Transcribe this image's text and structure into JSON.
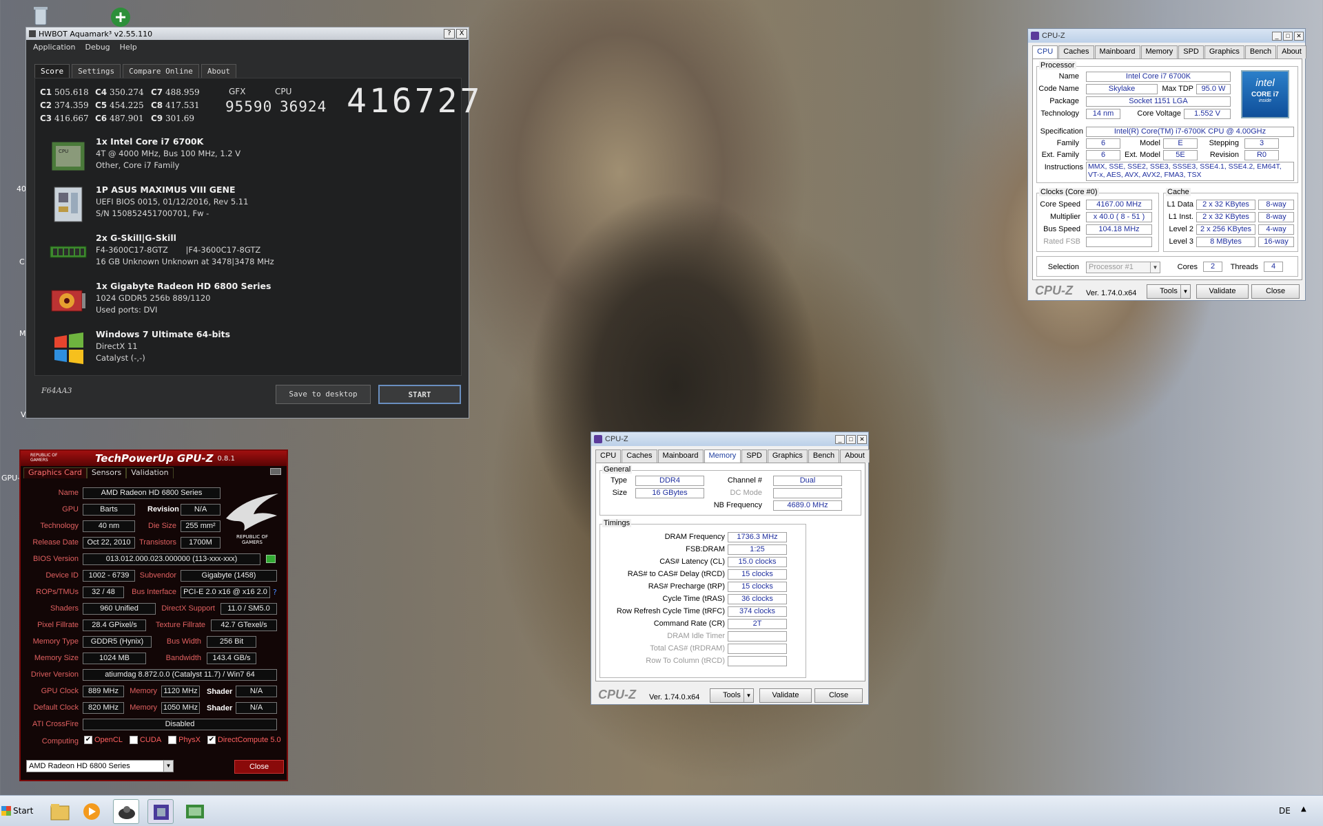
{
  "aquamark": {
    "title": "HWBOT Aquamark³ v2.55.110",
    "help_btn": "?",
    "close_btn": "X",
    "menu": [
      "Application",
      "Debug",
      "Help"
    ],
    "tabs": [
      "Score",
      "Settings",
      "Compare Online",
      "About"
    ],
    "chart_scores": [
      {
        "label": "C1",
        "value": "505.618"
      },
      {
        "label": "C2",
        "value": "374.359"
      },
      {
        "label": "C3",
        "value": "416.667"
      },
      {
        "label": "C4",
        "value": "350.274"
      },
      {
        "label": "C5",
        "value": "454.225"
      },
      {
        "label": "C6",
        "value": "487.901"
      },
      {
        "label": "C7",
        "value": "488.959"
      },
      {
        "label": "C8",
        "value": "417.531"
      },
      {
        "label": "C9",
        "value": "301.69"
      }
    ],
    "gfx_label": "GFX",
    "cpu_label": "CPU",
    "gfx_score": "95590",
    "cpu_score": "36924",
    "total_score": "416727",
    "system": [
      {
        "icon": "cpu-chip-icon",
        "lines": [
          "1x Intel Core i7 6700K",
          "4T @ 4000 MHz, Bus 100 MHz, 1.2 V",
          "Other, Core i7 Family"
        ]
      },
      {
        "icon": "motherboard-icon",
        "lines": [
          "1P ASUS MAXIMUS VIII GENE",
          "UEFI BIOS 0015, 01/12/2016, Rev 5.11",
          "S/N 150852451700701, Fw -"
        ]
      },
      {
        "icon": "memory-module-icon",
        "lines": [
          "2x G-Skill|G-Skill",
          "F4-3600C17-8GTZ       |F4-3600C17-8GTZ",
          "16 GB Unknown Unknown at 3478|3478 MHz"
        ]
      },
      {
        "icon": "graphics-card-icon",
        "lines": [
          "1x Gigabyte Radeon HD 6800 Series",
          "1024 GDDR5 256b 889/1120",
          "Used ports: DVI"
        ]
      },
      {
        "icon": "windows-logo-icon",
        "lines": [
          "Windows 7 Ultimate 64-bits",
          "DirectX 11",
          "Catalyst (-,-)"
        ]
      }
    ],
    "code": "F64AA3",
    "save_btn": "Save to desktop",
    "start_btn": "START"
  },
  "gpuz": {
    "brand": "REPUBLIC OF GAMERS",
    "title": "TechPowerUp GPU-Z",
    "version": "0.8.1",
    "tabs": [
      "Graphics Card",
      "Sensors",
      "Validation"
    ],
    "labels": {
      "name": "Name",
      "gpu": "GPU",
      "revision": "Revision",
      "technology": "Technology",
      "die_size": "Die Size",
      "release_date": "Release Date",
      "transistors": "Transistors",
      "bios_version": "BIOS Version",
      "device_id": "Device ID",
      "subvendor": "Subvendor",
      "rops": "ROPs/TMUs",
      "bus_interface": "Bus Interface",
      "shaders": "Shaders",
      "directx": "DirectX Support",
      "pixel_fillrate": "Pixel Fillrate",
      "texture_fillrate": "Texture Fillrate",
      "memory_type": "Memory Type",
      "bus_width": "Bus Width",
      "memory_size": "Memory Size",
      "bandwidth": "Bandwidth",
      "driver_version": "Driver Version",
      "gpu_clock": "GPU Clock",
      "memory": "Memory",
      "shader": "Shader",
      "default_clock": "Default Clock",
      "crossfire": "ATI CrossFire",
      "computing": "Computing"
    },
    "values": {
      "name": "AMD Radeon HD 6800 Series",
      "gpu": "Barts",
      "revision": "N/A",
      "technology": "40 nm",
      "die_size": "255 mm²",
      "release_date": "Oct 22, 2010",
      "transistors": "1700M",
      "bios_version": "013.012.000.023.000000 (113-xxx-xxx)",
      "device_id": "1002 - 6739",
      "subvendor": "Gigabyte (1458)",
      "rops": "32 / 48",
      "bus_interface": "PCI-E 2.0 x16 @ x16 2.0",
      "shaders": "960 Unified",
      "directx": "11.0 / SM5.0",
      "pixel_fillrate": "28.4 GPixel/s",
      "texture_fillrate": "42.7 GTexel/s",
      "memory_type": "GDDR5 (Hynix)",
      "bus_width": "256 Bit",
      "memory_size": "1024 MB",
      "bandwidth": "143.4 GB/s",
      "driver_version": "atiumdag 8.872.0.0 (Catalyst 11.7) / Win7 64",
      "gpu_clock": "889 MHz",
      "gpu_memory": "1120 MHz",
      "gpu_shader": "N/A",
      "default_clock": "820 MHz",
      "default_memory": "1050 MHz",
      "default_shader": "N/A",
      "crossfire": "Disabled"
    },
    "computing": [
      {
        "label": "OpenCL",
        "checked": true
      },
      {
        "label": "CUDA",
        "checked": false
      },
      {
        "label": "PhysX",
        "checked": false
      },
      {
        "label": "DirectCompute 5.0",
        "checked": true
      }
    ],
    "selected_card": "AMD Radeon HD 6800 Series",
    "close_btn": "Close",
    "logo_text": "REPUBLIC OF GAMERS"
  },
  "cpuz_main": {
    "title": "CPU-Z",
    "tabs": [
      "CPU",
      "Caches",
      "Mainboard",
      "Memory",
      "SPD",
      "Graphics",
      "Bench",
      "About"
    ],
    "processor_legend": "Processor",
    "name_label": "Name",
    "name": "Intel Core i7 6700K",
    "codename_label": "Code Name",
    "codename": "Skylake",
    "maxtdp_label": "Max TDP",
    "maxtdp": "95.0 W",
    "package_label": "Package",
    "package": "Socket 1151 LGA",
    "technology_label": "Technology",
    "technology": "14 nm",
    "corevoltage_label": "Core Voltage",
    "corevoltage": "1.552 V",
    "spec_label": "Specification",
    "spec": "Intel(R) Core(TM) i7-6700K CPU @ 4.00GHz",
    "family_label": "Family",
    "family": "6",
    "model_label": "Model",
    "model": "E",
    "stepping_label": "Stepping",
    "stepping": "3",
    "extfamily_label": "Ext. Family",
    "extfamily": "6",
    "extmodel_label": "Ext. Model",
    "extmodel": "5E",
    "revision_label": "Revision",
    "revision": "R0",
    "instructions_label": "Instructions",
    "instructions": "MMX, SSE, SSE2, SSE3, SSSE3, SSE4.1, SSE4.2, EM64T, VT-x, AES, AVX, AVX2, FMA3, TSX",
    "clocks_legend": "Clocks (Core #0)",
    "corespeed_label": "Core Speed",
    "corespeed": "4167.00 MHz",
    "multiplier_label": "Multiplier",
    "multiplier": "x 40.0 ( 8 - 51 )",
    "busspeed_label": "Bus Speed",
    "busspeed": "104.18 MHz",
    "ratedfsb_label": "Rated FSB",
    "ratedfsb": "",
    "cache_legend": "Cache",
    "l1d_label": "L1 Data",
    "l1d": "2 x 32 KBytes",
    "l1d_way": "8-way",
    "l1i_label": "L1 Inst.",
    "l1i": "2 x 32 KBytes",
    "l1i_way": "8-way",
    "l2_label": "Level 2",
    "l2": "2 x 256 KBytes",
    "l2_way": "4-way",
    "l3_label": "Level 3",
    "l3": "8 MBytes",
    "l3_way": "16-way",
    "selection_label": "Selection",
    "selection": "Processor #1",
    "cores_label": "Cores",
    "cores": "2",
    "threads_label": "Threads",
    "threads": "4",
    "logo": "CPU-Z",
    "version": "Ver. 1.74.0.x64",
    "tools_btn": "Tools",
    "validate_btn": "Validate",
    "close_btn": "Close",
    "intel_badge": {
      "brand": "intel",
      "line1": "CORE i7",
      "line2": "inside"
    }
  },
  "cpuz_mem": {
    "title": "CPU-Z",
    "tabs": [
      "CPU",
      "Caches",
      "Mainboard",
      "Memory",
      "SPD",
      "Graphics",
      "Bench",
      "About"
    ],
    "general_legend": "General",
    "type_label": "Type",
    "type": "DDR4",
    "channel_label": "Channel #",
    "channel": "Dual",
    "size_label": "Size",
    "size": "16 GBytes",
    "dcmode_label": "DC Mode",
    "dcmode": "",
    "nbfreq_label": "NB Frequency",
    "nbfreq": "4689.0 MHz",
    "timings_legend": "Timings",
    "timings": [
      {
        "label": "DRAM Frequency",
        "value": "1736.3 MHz",
        "dim": false
      },
      {
        "label": "FSB:DRAM",
        "value": "1:25",
        "dim": false
      },
      {
        "label": "CAS# Latency (CL)",
        "value": "15.0 clocks",
        "dim": false
      },
      {
        "label": "RAS# to CAS# Delay (tRCD)",
        "value": "15 clocks",
        "dim": false
      },
      {
        "label": "RAS# Precharge (tRP)",
        "value": "15 clocks",
        "dim": false
      },
      {
        "label": "Cycle Time (tRAS)",
        "value": "36 clocks",
        "dim": false
      },
      {
        "label": "Row Refresh Cycle Time (tRFC)",
        "value": "374 clocks",
        "dim": false
      },
      {
        "label": "Command Rate (CR)",
        "value": "2T",
        "dim": false
      },
      {
        "label": "DRAM Idle Timer",
        "value": "",
        "dim": true
      },
      {
        "label": "Total CAS# (tRDRAM)",
        "value": "",
        "dim": true
      },
      {
        "label": "Row To Column (tRCD)",
        "value": "",
        "dim": true
      }
    ],
    "logo": "CPU-Z",
    "version": "Ver. 1.74.0.x64",
    "tools_btn": "Tools",
    "validate_btn": "Validate",
    "close_btn": "Close"
  },
  "desktop_fragments": [
    "40",
    "C",
    "M",
    "GPU-",
    "V"
  ],
  "taskbar": {
    "start_label": "Start",
    "items": [
      "explorer-folder-icon",
      "media-player-icon",
      "aquamark-app-icon",
      "cpuz-app-icon",
      "gpuz-app-icon"
    ],
    "language": "DE"
  }
}
